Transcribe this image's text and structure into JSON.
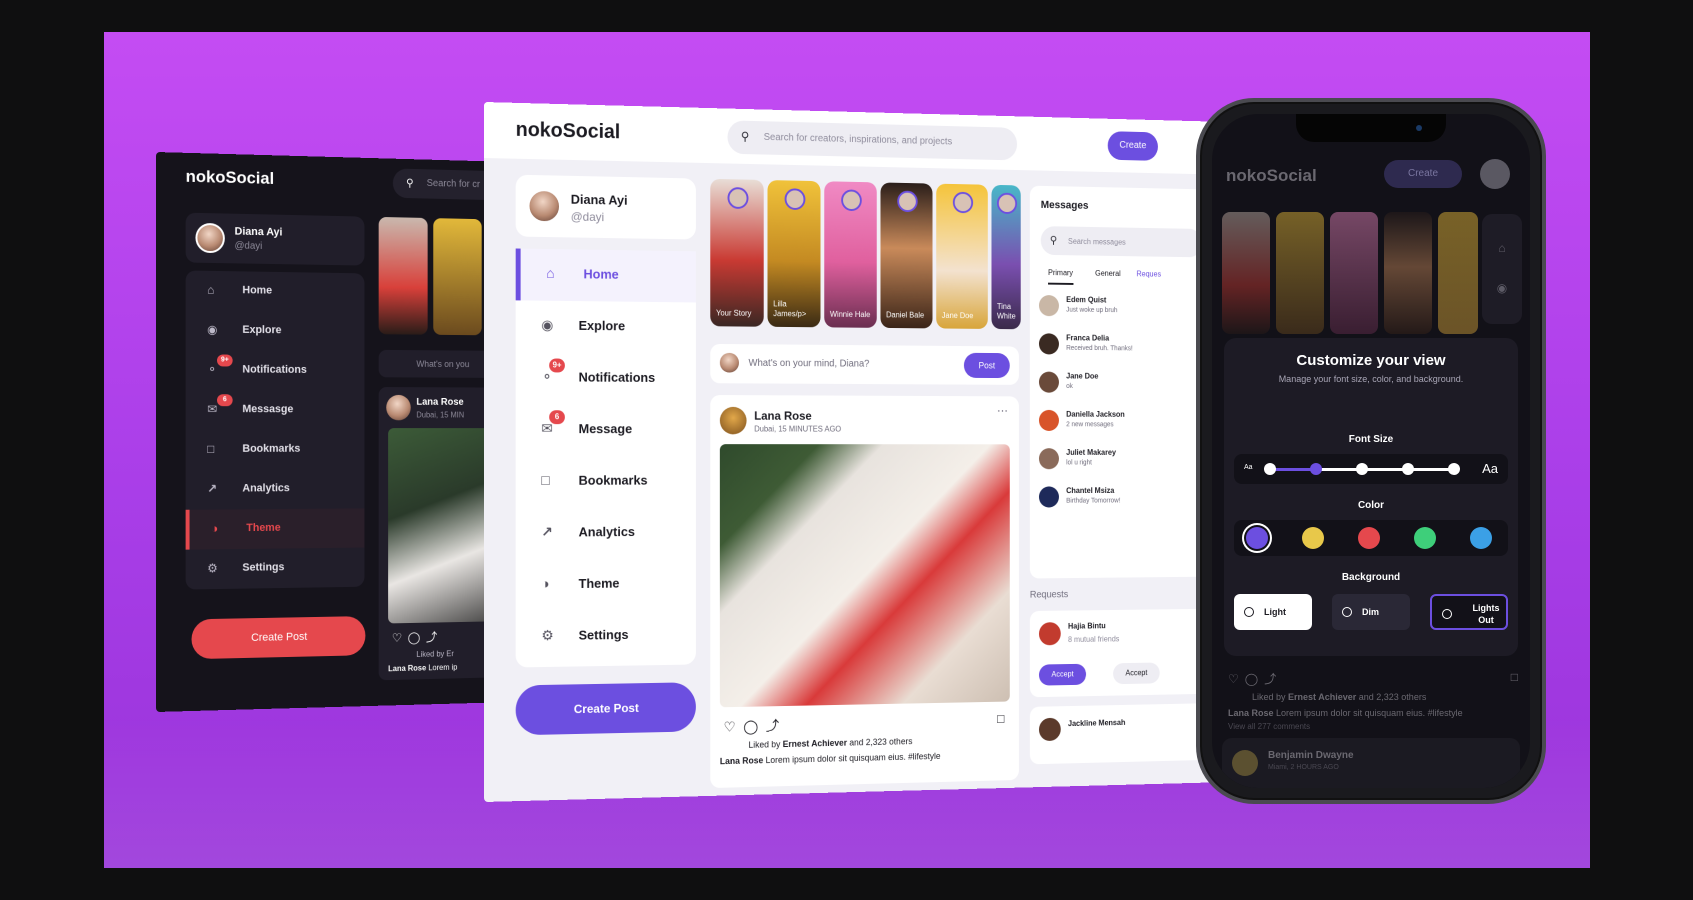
{
  "brand": {
    "name": "nokoSocial"
  },
  "colors": {
    "stage": "#bd48f2",
    "primary": "#6c4fe0",
    "danger": "#e5484d"
  },
  "user": {
    "name": "Diana Ayi",
    "handle": "@dayi"
  },
  "search": {
    "placeholder": "Search for creators, inspirations, and projects",
    "placeholder_dark": "Search for cr"
  },
  "header": {
    "create_label": "Create"
  },
  "nav": {
    "items": [
      {
        "label": "Home",
        "icon": "home-icon"
      },
      {
        "label": "Explore",
        "icon": "compass-icon"
      },
      {
        "label": "Notifications",
        "icon": "bell-icon",
        "badge": "9+"
      },
      {
        "label": "Message",
        "icon": "mail-icon",
        "badge": "6"
      },
      {
        "label": "Bookmarks",
        "icon": "bookmark-icon"
      },
      {
        "label": "Analytics",
        "icon": "chart-icon"
      },
      {
        "label": "Theme",
        "icon": "palette-icon"
      },
      {
        "label": "Settings",
        "icon": "gear-icon"
      }
    ],
    "dark_message_label": "Messasge",
    "create_post": "Create Post"
  },
  "stories": [
    {
      "name": "Your Story"
    },
    {
      "name": "Lilla James/p>"
    },
    {
      "name": "Winnie Hale"
    },
    {
      "name": "Daniel Bale"
    },
    {
      "name": "Jane Doe"
    },
    {
      "name": "Tina White"
    }
  ],
  "composer": {
    "placeholder": "What's on your mind, Diana?",
    "placeholder_dark": "What's on you",
    "post_label": "Post"
  },
  "feed": {
    "author": "Lana Rose",
    "location": "Dubai, 15 MINUTES AGO",
    "location_dark": "Dubai, 15 MIN",
    "liked_prefix": "Liked by",
    "liked_user": "Ernest Achiever",
    "liked_suffix": "and 2,323 others",
    "liked_dark": "Liked by Er",
    "caption_author": "Lana Rose",
    "caption": "Lorem ipsum dolor sit quisquam eius. #lifestyle",
    "caption_dark": "Lorem ip",
    "view_all": "View all 277 comments",
    "next_author": "Benjamin Dwayne",
    "next_location": "Miami, 2 HOURS AGO"
  },
  "messages": {
    "title": "Messages",
    "search_placeholder": "Search messages",
    "tabs": [
      "Primary",
      "General",
      "Reques"
    ],
    "list": [
      {
        "name": "Edem Quist",
        "text": "Just woke up bruh"
      },
      {
        "name": "Franca Delia",
        "text": "Received bruh. Thanks!"
      },
      {
        "name": "Jane Doe",
        "text": "ok"
      },
      {
        "name": "Daniella Jackson",
        "text": "2 new messages"
      },
      {
        "name": "Juliet Makarey",
        "text": "lol u right"
      },
      {
        "name": "Chantel Msiza",
        "text": "Birthday Tomorrow!"
      }
    ]
  },
  "requests": {
    "title": "Requests",
    "first": {
      "name": "Hajia Bintu",
      "mutual": "8 mutual friends",
      "accept": "Accept",
      "decline": "Accept"
    },
    "second": {
      "name": "Jackline Mensah"
    }
  },
  "customize": {
    "title": "Customize your view",
    "subtitle": "Manage your font size, color, and background.",
    "font_size_label": "Font Size",
    "font_small": "Aa",
    "font_large": "Aa",
    "font_size_level": 2,
    "font_size_levels": 5,
    "color_label": "Color",
    "swatches": [
      "#6c4fe0",
      "#e8c84a",
      "#e5484d",
      "#3ecf7a",
      "#3ba0e6"
    ],
    "selected_swatch": 0,
    "background_label": "Background",
    "backgrounds": [
      "Light",
      "Dim",
      "Lights Out"
    ],
    "selected_background": 2
  }
}
